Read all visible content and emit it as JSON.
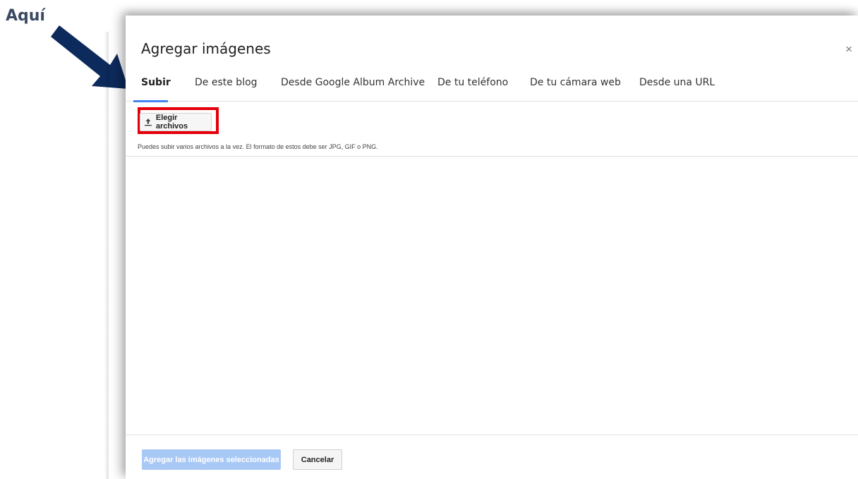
{
  "annotation": {
    "label": "Aquí",
    "arrow_color": "#0d2a5c",
    "highlight_color": "#e3000b"
  },
  "dialog": {
    "title": "Agregar imágenes",
    "close_symbol": "×",
    "tabs": [
      {
        "label": "Subir",
        "active": true
      },
      {
        "label": "De este blog"
      },
      {
        "label": "Desde Google Album Archive"
      },
      {
        "label": "De tu teléfono"
      },
      {
        "label": "De tu cámara web"
      },
      {
        "label": "Desde una URL"
      }
    ],
    "choose_files_label": "Elegir archivos",
    "choose_files_icon": "upload-icon",
    "help_text": "Puedes subir varios archivos a la vez. El formato de estos debe ser JPG, GIF o PNG.",
    "add_button_label": "Agregar las imágenes seleccionadas",
    "cancel_button_label": "Cancelar",
    "accent_color": "#4285f4",
    "disabled_button_color": "#a8c8f5"
  }
}
